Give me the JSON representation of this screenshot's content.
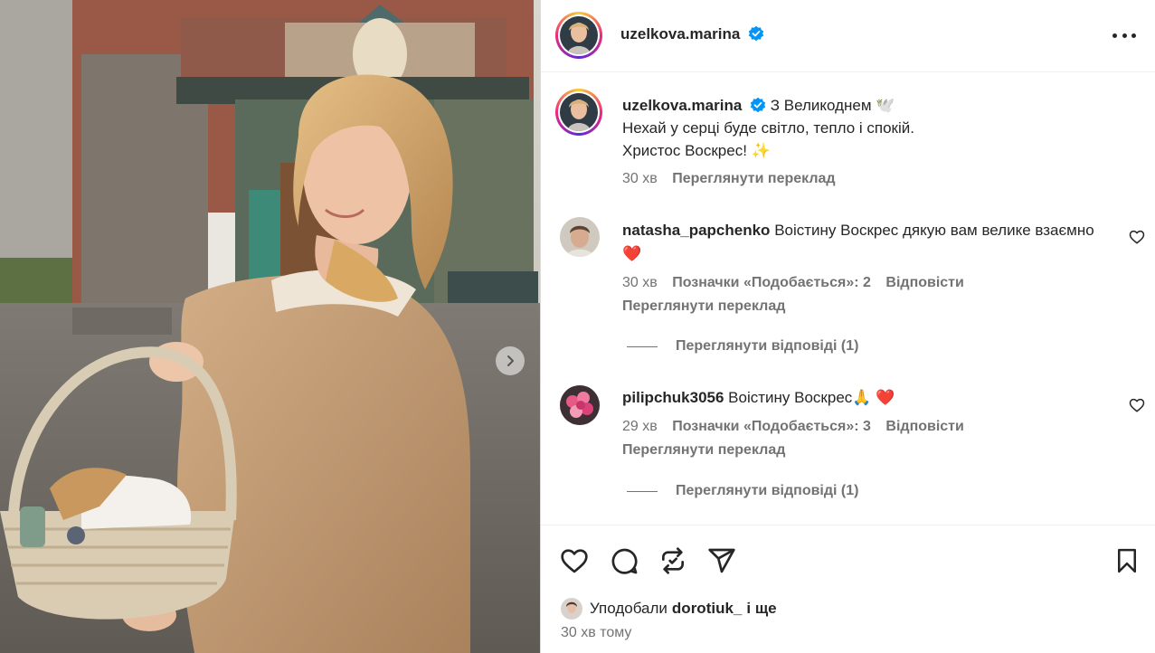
{
  "post": {
    "author": "uzelkova.marina",
    "caption_lines": [
      "З Великоднем 🕊️",
      "Нехай у серці буде світло, тепло і спокій.",
      "Христос Воскрес! ✨"
    ],
    "time": "30 хв",
    "see_translation": "Переглянути переклад"
  },
  "comments": [
    {
      "user": "natasha_papchenko",
      "text": "Воістину Воскрес дякую вам велике взаємно ❤️",
      "time": "30 хв",
      "likes": "Позначки «Подобається»: 2",
      "reply": "Відповісти",
      "see_translation": "Переглянути переклад",
      "view_replies": "Переглянути відповіді (1)"
    },
    {
      "user": "pilipchuk3056",
      "text": "Воістину Воскрес🙏 ❤️",
      "time": "29 хв",
      "likes": "Позначки «Подобається»: 3",
      "reply": "Відповісти",
      "see_translation": "Переглянути переклад",
      "view_replies": "Переглянути відповіді (1)"
    }
  ],
  "footer": {
    "liked_prefix": "Уподобали",
    "liked_user": "dorotiuk_",
    "liked_suffix": "і ще",
    "ago": "30 хв тому"
  },
  "icons": [
    "verified-icon",
    "more-icon",
    "heart-icon",
    "comment-icon",
    "repost-icon",
    "share-icon",
    "bookmark-icon",
    "chevron-right-icon"
  ],
  "colors": {
    "verified": "#0095f6",
    "heart_red": "#ed4956",
    "text_secondary": "#737373"
  }
}
